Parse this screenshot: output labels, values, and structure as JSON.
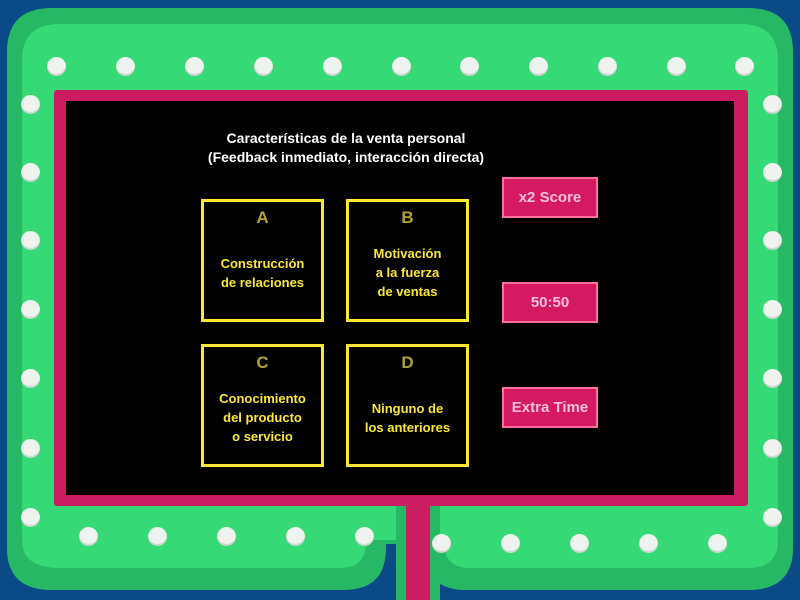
{
  "question": {
    "line1": "Características de la venta personal",
    "line2": "(Feedback inmediato, interacción directa)"
  },
  "answers": [
    {
      "letter": "A",
      "text": "Construcción\nde relaciones"
    },
    {
      "letter": "B",
      "text": "Motivación\na la fuerza\nde ventas"
    },
    {
      "letter": "C",
      "text": "Conocimiento\ndel producto\no servicio"
    },
    {
      "letter": "D",
      "text": "Ninguno de\nlos anteriores"
    }
  ],
  "powerups": {
    "double_score": "x2 Score",
    "fifty_fifty": "50:50",
    "extra_time": "Extra Time"
  },
  "colors": {
    "background": "#0a4a86",
    "frame_outer": "#27b865",
    "frame_inner": "#35d975",
    "screen_border": "#cc1c62",
    "screen": "#000000",
    "answer": "#fbe834",
    "powerup": "#d61a62"
  }
}
